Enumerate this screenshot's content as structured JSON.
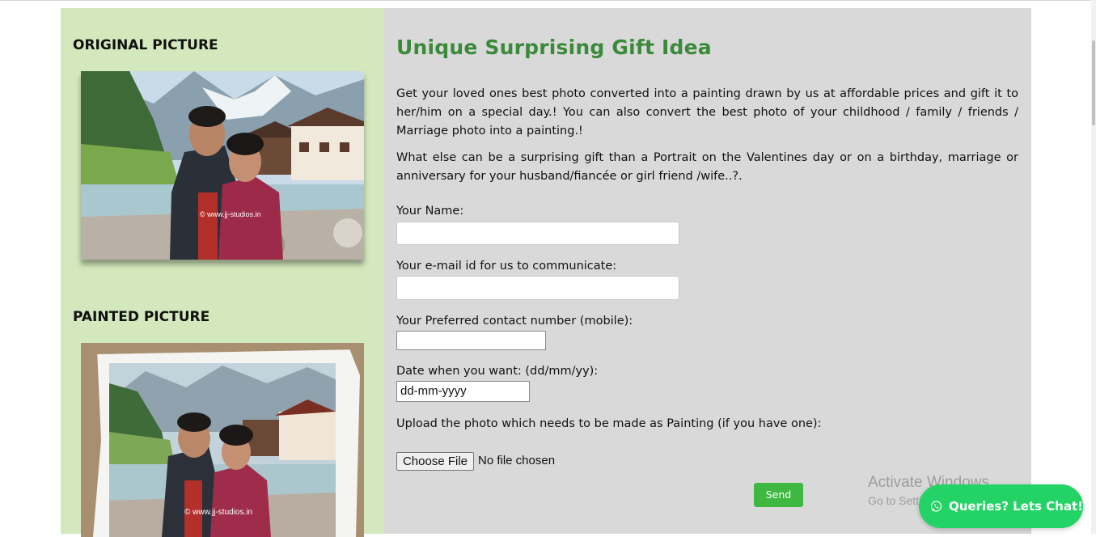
{
  "left": {
    "original_title": "ORIGINAL PICTURE",
    "painted_title": "PAINTED PICTURE",
    "photo_watermark": "© www.jj-studios.in"
  },
  "main": {
    "heading": "Unique Surprising Gift Idea",
    "para1": "Get your loved ones best photo converted into a painting drawn by us at affordable prices and gift it to her/him on a special day.! You can also convert the best photo of your childhood / family / friends / Marriage photo into a painting.!",
    "para2": "What else can be a surprising gift than a Portrait on the Valentines day or on a birthday, marriage or anniversary for your husband/fiancée or girl friend /wife..?.",
    "form": {
      "name_label": "Your Name:",
      "email_label": "Your e-mail id for us to communicate:",
      "phone_label": "Your Preferred contact number (mobile):",
      "date_label": "Date when you want: (dd/mm/yy):",
      "date_value": "dd-mm-yyyy",
      "upload_label": "Upload the photo which needs to be made as Painting (if you have one):",
      "choose_file": "Choose File",
      "file_status": "No file chosen",
      "send": "Send"
    }
  },
  "overlay": {
    "watermark_title": "Activate Windows",
    "watermark_sub": "Go to Settings to activate Windows."
  },
  "chat": {
    "label": "Queries? Lets Chat!",
    "icon": "whatsapp-icon",
    "color": "#24d366"
  },
  "colors": {
    "left_panel": "#d3e9bd",
    "right_panel": "#d9d9d9",
    "heading": "#3b8a3a",
    "send_button": "#3fb842"
  }
}
